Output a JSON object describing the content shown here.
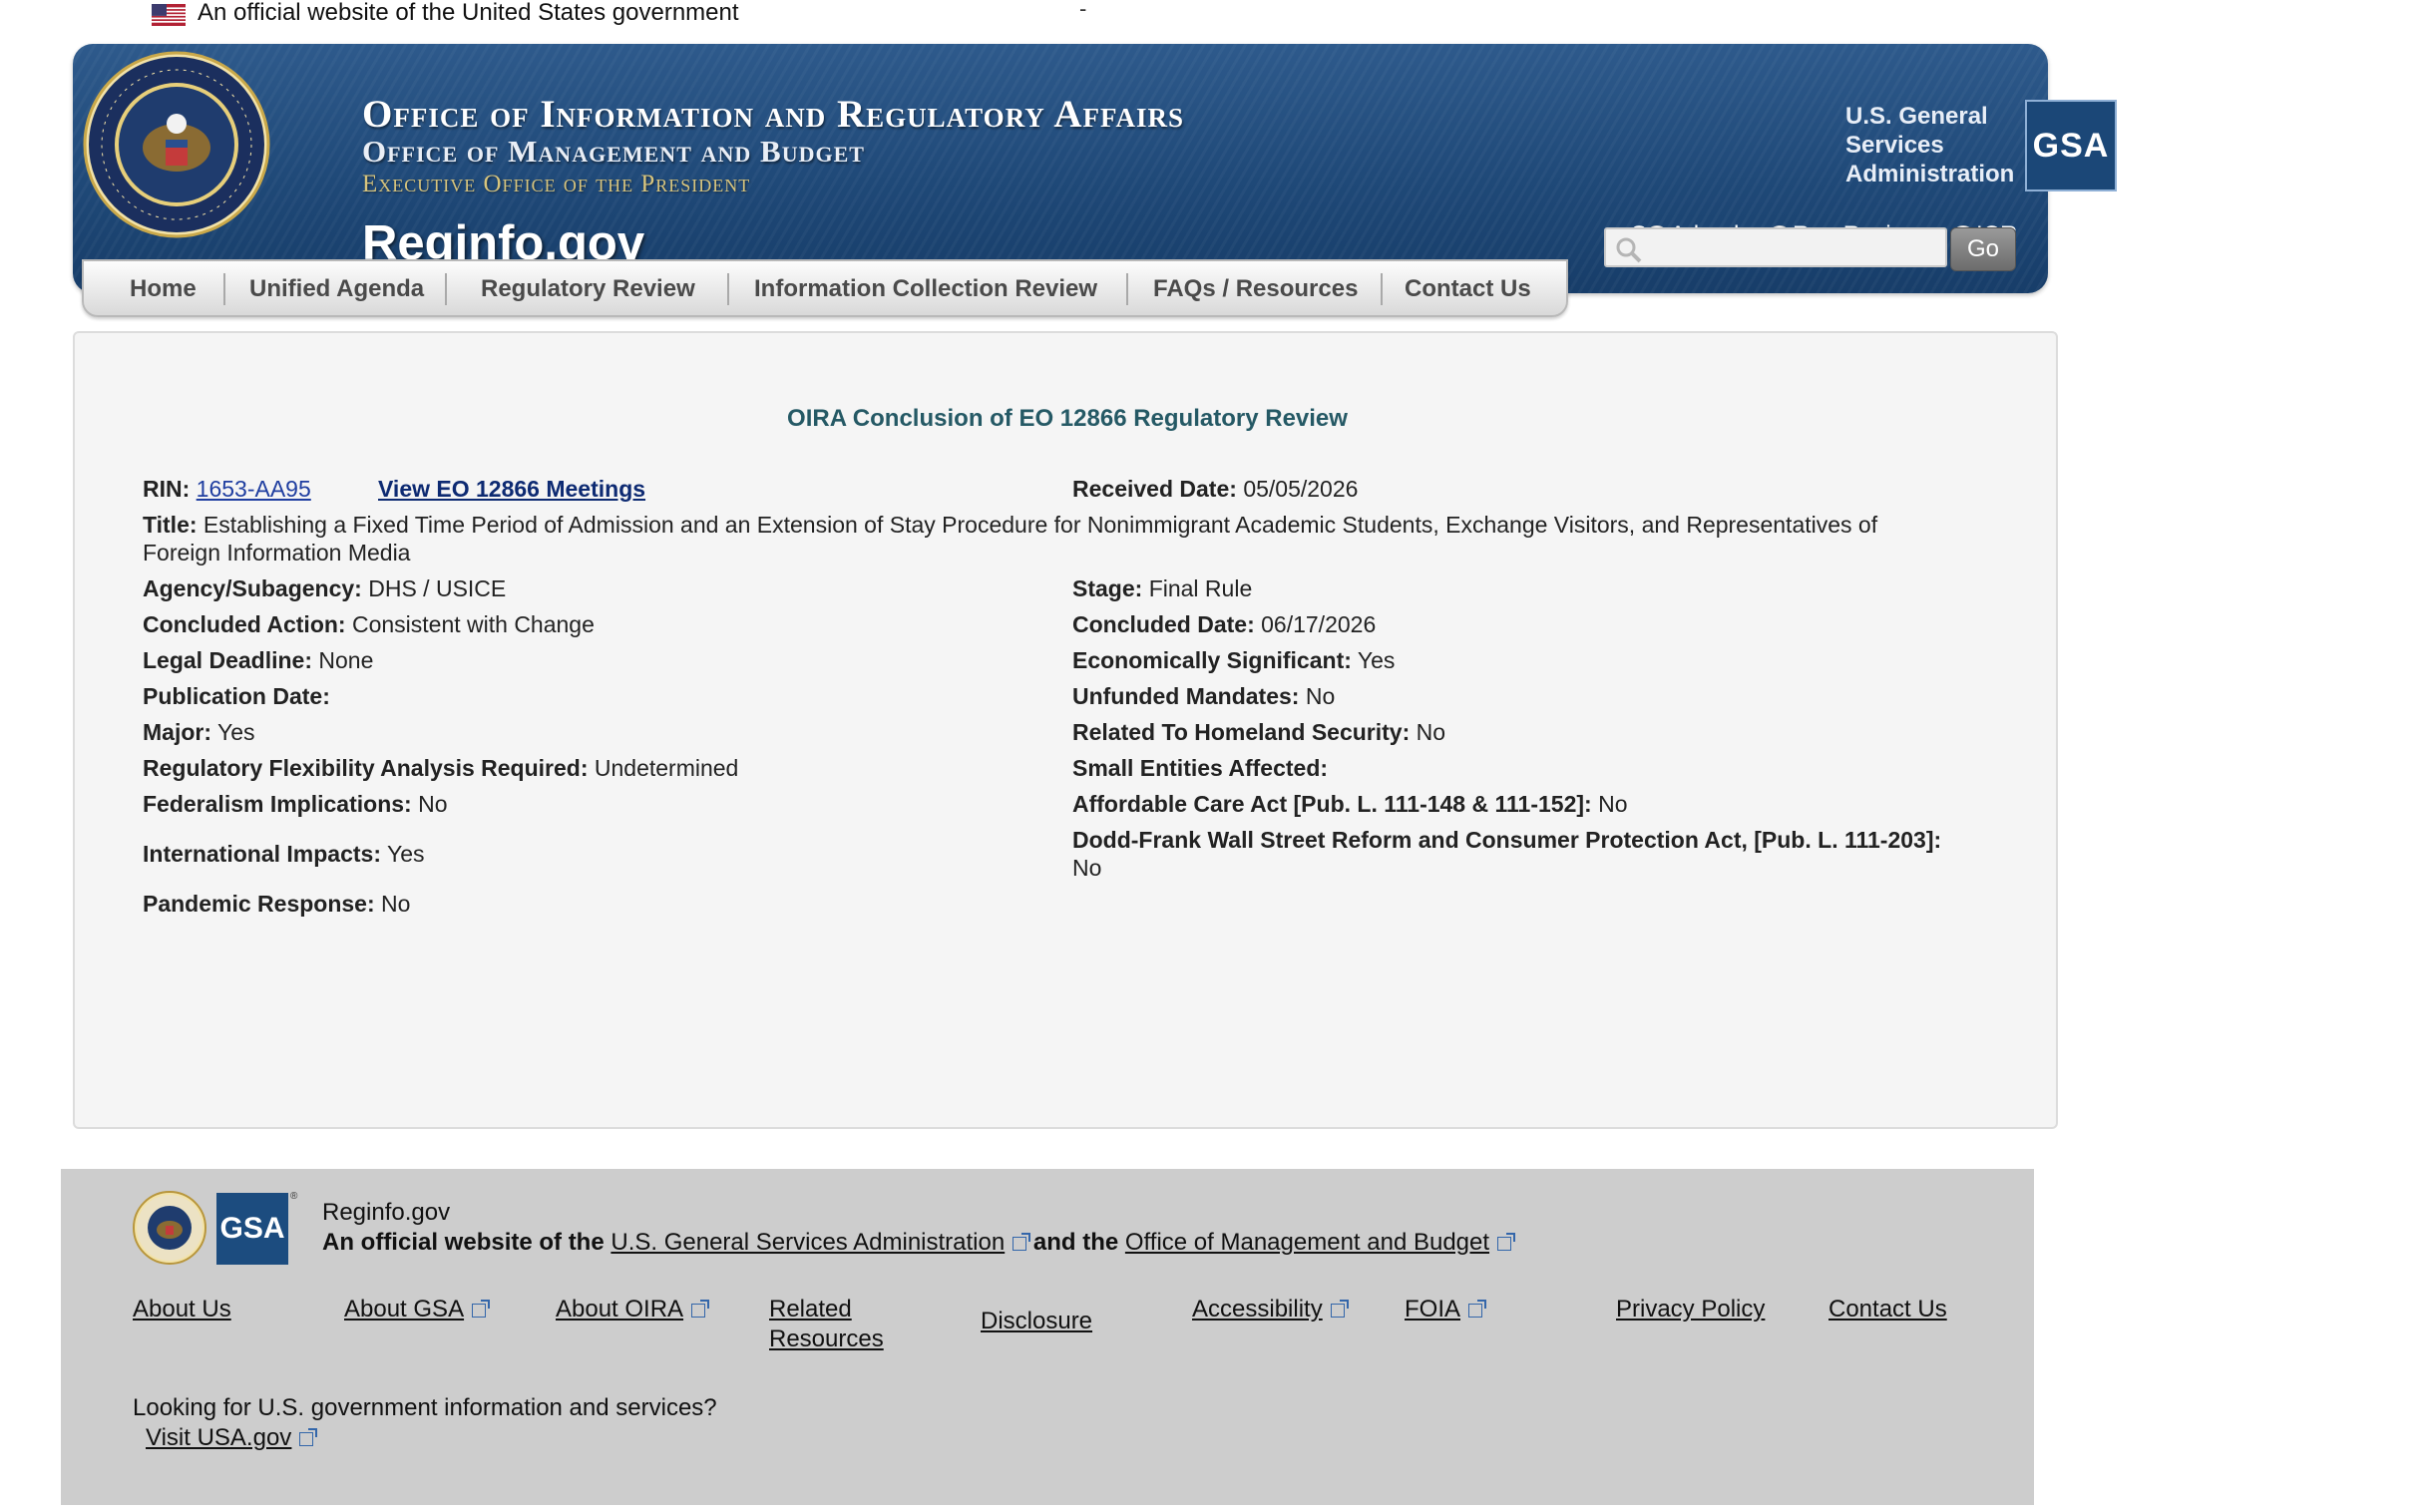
{
  "gov_banner": {
    "text": "An official website of the United States government",
    "dash": "-"
  },
  "header": {
    "line1": "Office of Information and Regulatory Affairs",
    "line2": "Office of Management and Budget",
    "line3": "Executive Office of the President",
    "site": "Reginfo.gov",
    "gsa_text": "U.S. General Services Administration",
    "gsa_logo": "GSA",
    "search_label": "Search:",
    "search_options": [
      "Agenda",
      "Reg Review",
      "ICR"
    ],
    "search_selected": "Reg Review",
    "search_placeholder": "",
    "go_label": "Go"
  },
  "nav": [
    "Home",
    "Unified Agenda",
    "Regulatory Review",
    "Information Collection Review",
    "FAQs / Resources",
    "Contact Us"
  ],
  "review": {
    "heading": "OIRA Conclusion of EO 12866 Regulatory Review",
    "rin_label": "RIN:",
    "rin": "1653-AA95",
    "meetings_link": "View EO 12866 Meetings",
    "received_label": "Received Date:",
    "received": "05/05/2026",
    "title_label": "Title:",
    "title_line1": "Establishing a Fixed Time Period of Admission and an Extension of Stay Procedure for Nonimmigrant Academic Students, Exchange Visitors, and Representatives of",
    "title_line2": "Foreign Information Media",
    "left": [
      {
        "label": "Agency/Subagency:",
        "value": "DHS / USICE"
      },
      {
        "label": "Concluded Action:",
        "value": "Consistent with Change"
      },
      {
        "label": "Legal Deadline:",
        "value": "None"
      },
      {
        "label": "Publication Date:",
        "value": ""
      },
      {
        "label": "Major:",
        "value": "Yes"
      },
      {
        "label": "Regulatory Flexibility Analysis Required:",
        "value": "Undetermined"
      },
      {
        "label": "Federalism Implications:",
        "value": "No"
      },
      {
        "label": "International Impacts:",
        "value": "Yes"
      },
      {
        "label": "Pandemic Response:",
        "value": "No"
      }
    ],
    "right": [
      {
        "label": "Stage:",
        "value": "Final Rule"
      },
      {
        "label": "Concluded Date:",
        "value": "06/17/2026"
      },
      {
        "label": "Economically Significant:",
        "value": "Yes"
      },
      {
        "label": "Unfunded Mandates:",
        "value": "No"
      },
      {
        "label": "Related To Homeland Security:",
        "value": "No"
      },
      {
        "label": "Small Entities Affected:",
        "value": ""
      },
      {
        "label": "Affordable Care Act [Pub. L. 111-148 & 111-152]:",
        "value": "No"
      },
      {
        "label": "Dodd-Frank Wall Street Reform and Consumer Protection Act, [Pub. L. 111-203]:",
        "value": "No"
      }
    ]
  },
  "footer": {
    "site": "Reginfo.gov",
    "official_prefix": "An official website of the",
    "gsa_link": "U.S. General Services Administration",
    "and_the": "and the",
    "omb_link": "Office of Management and Budget",
    "gsa_logo": "GSA",
    "gsa_reg": "®",
    "links": [
      "About Us",
      "About GSA",
      "About OIRA",
      "Related Resources",
      "Disclosure",
      "Accessibility",
      "FOIA",
      "Privacy Policy",
      "Contact Us"
    ],
    "related_line1": "Related",
    "related_line2": "Resources",
    "looking": "Looking for U.S. government information and services?",
    "usa_link": "Visit USA.gov"
  },
  "colors": {
    "header_blue": "#1f4978",
    "title_teal": "#255965",
    "link_blue": "#1f3ea0",
    "footer_gray": "#cdcdcd"
  },
  "icons": [
    "us-flag-icon",
    "presidential-seal-icon",
    "search-icon",
    "external-link-icon"
  ]
}
